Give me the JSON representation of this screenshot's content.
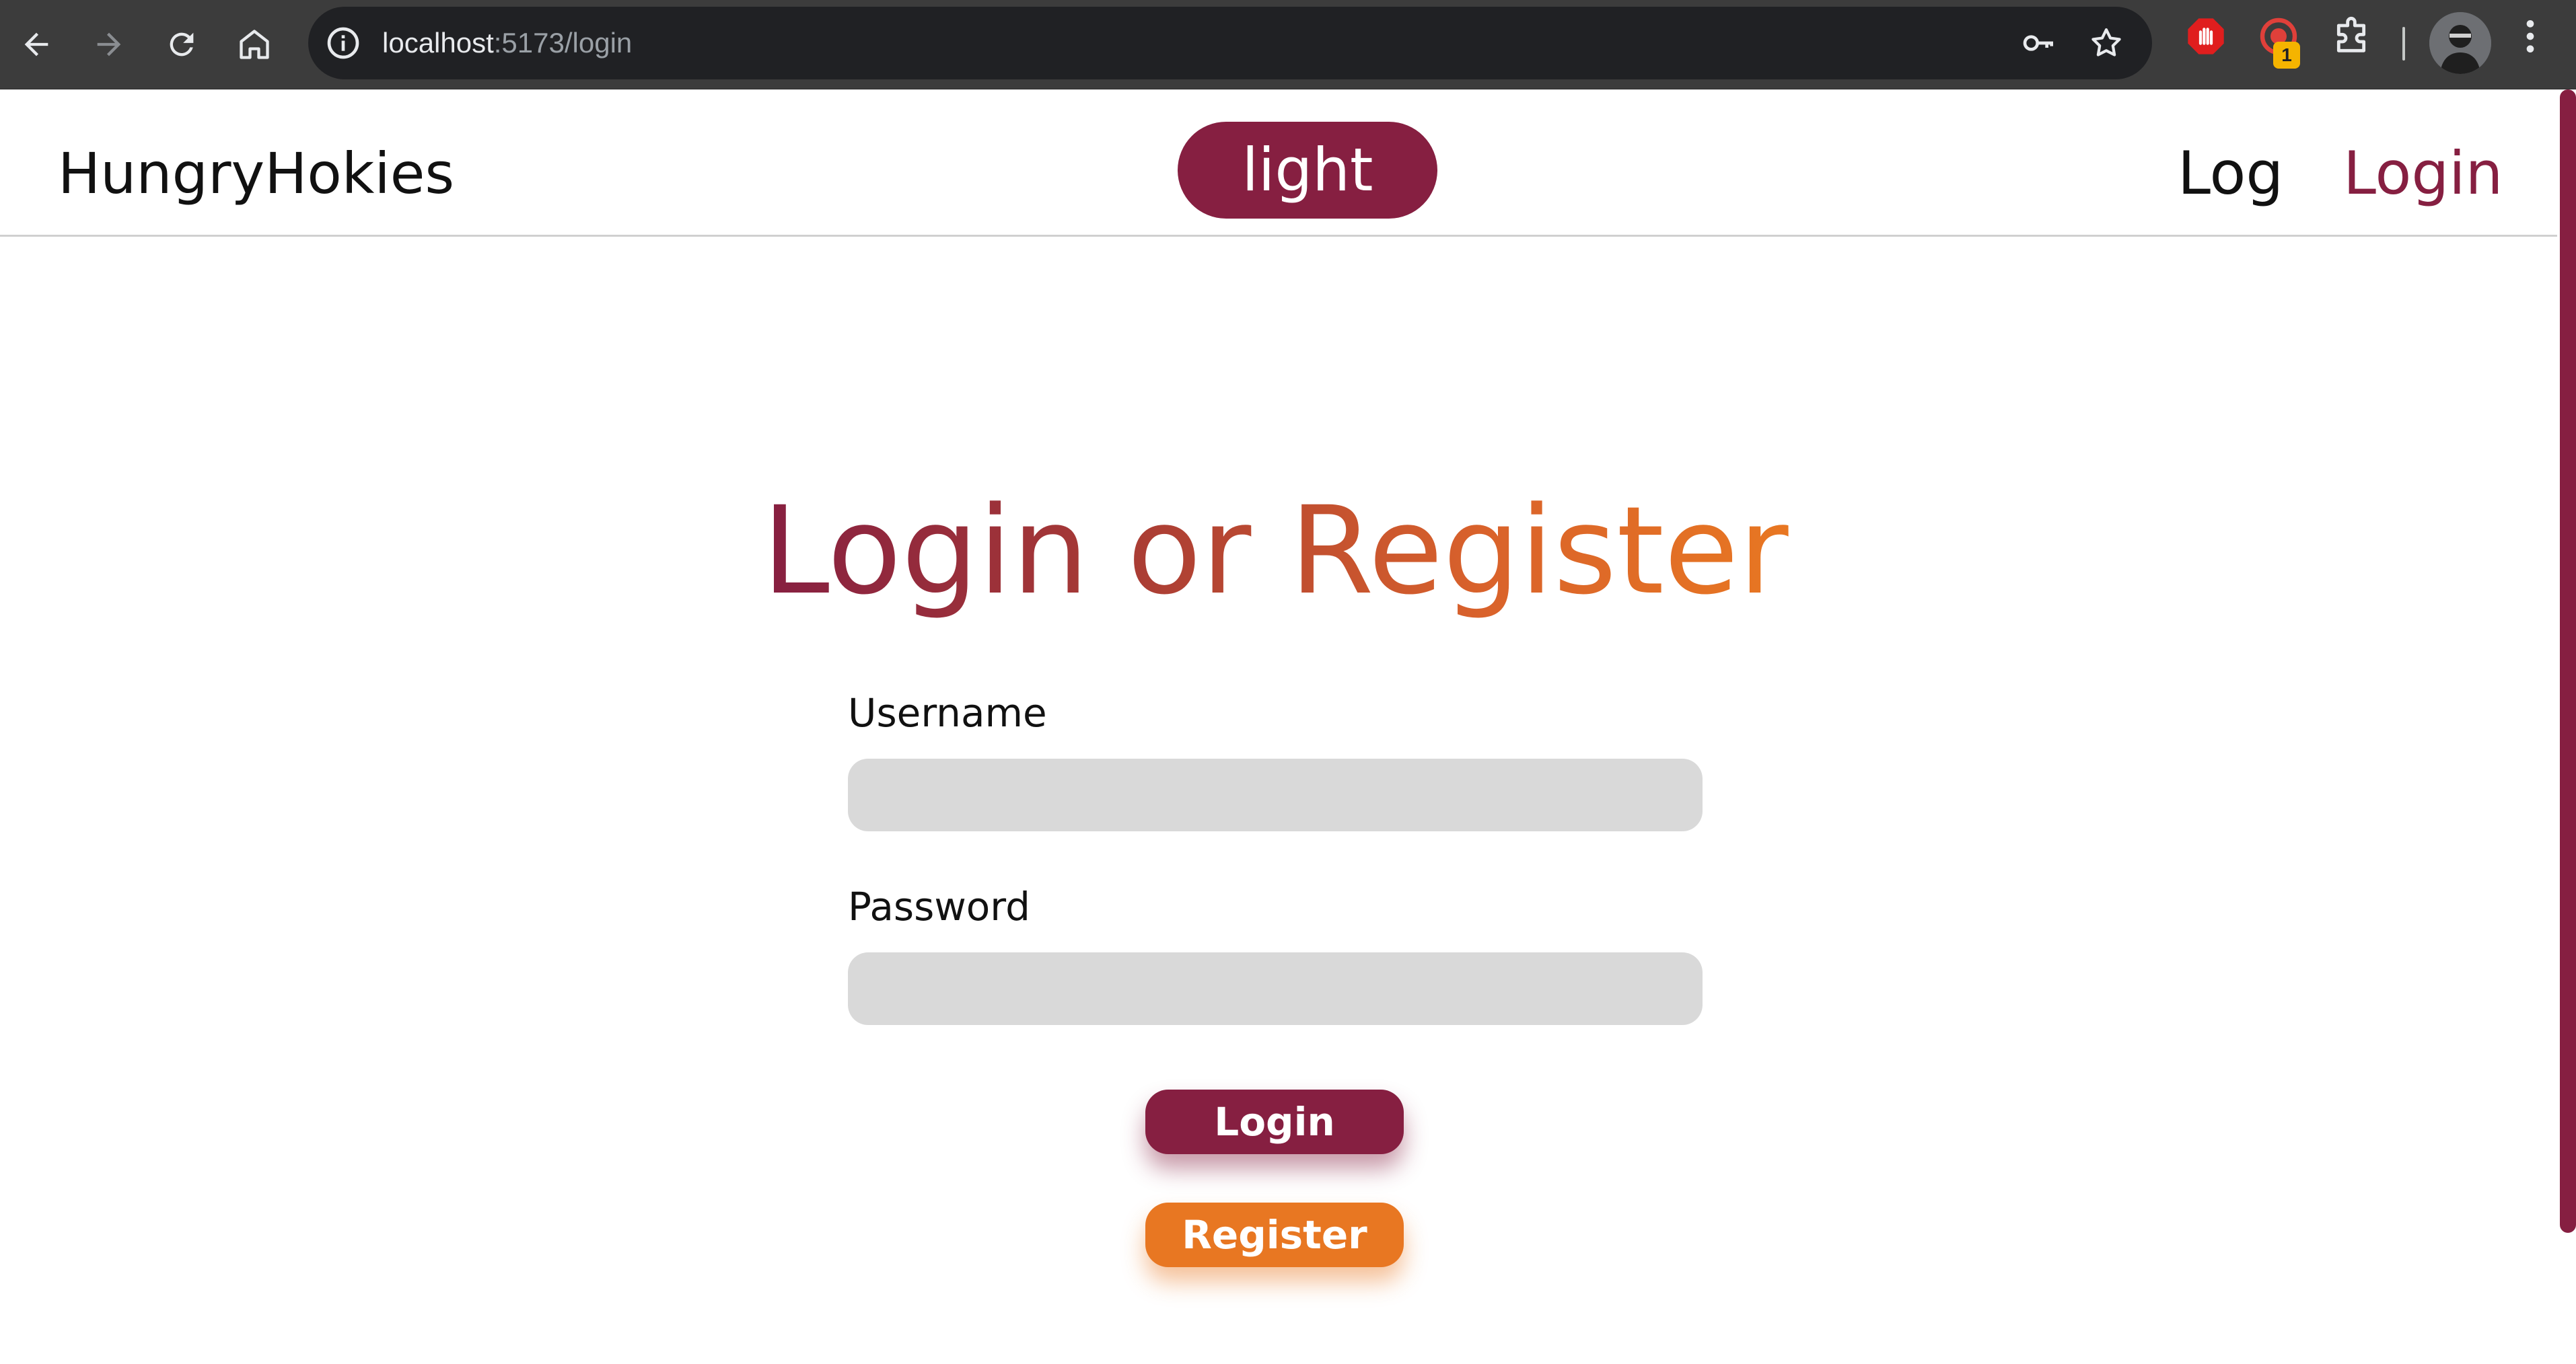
{
  "browser": {
    "url_host": "localhost",
    "url_path": ":5173/login",
    "extension_badge": "1"
  },
  "header": {
    "brand": "HungryHokies",
    "theme_toggle_label": "light",
    "nav": {
      "log": "Log",
      "login": "Login"
    }
  },
  "main": {
    "title": "Login or Register",
    "username_label": "Username",
    "password_label": "Password",
    "username_value": "",
    "password_value": "",
    "login_button": "Login",
    "register_button": "Register"
  },
  "colors": {
    "maroon": "#861f41",
    "orange": "#e87722",
    "input_bg": "#d9d9d9",
    "chrome_bg": "#3c3c3c"
  },
  "icons": [
    "back-arrow-icon",
    "forward-arrow-icon",
    "reload-icon",
    "home-icon",
    "site-info-icon",
    "password-key-icon",
    "bookmark-star-icon",
    "adblock-stop-icon",
    "extension-target-icon",
    "extensions-puzzle-icon",
    "chrome-menu-icon"
  ]
}
